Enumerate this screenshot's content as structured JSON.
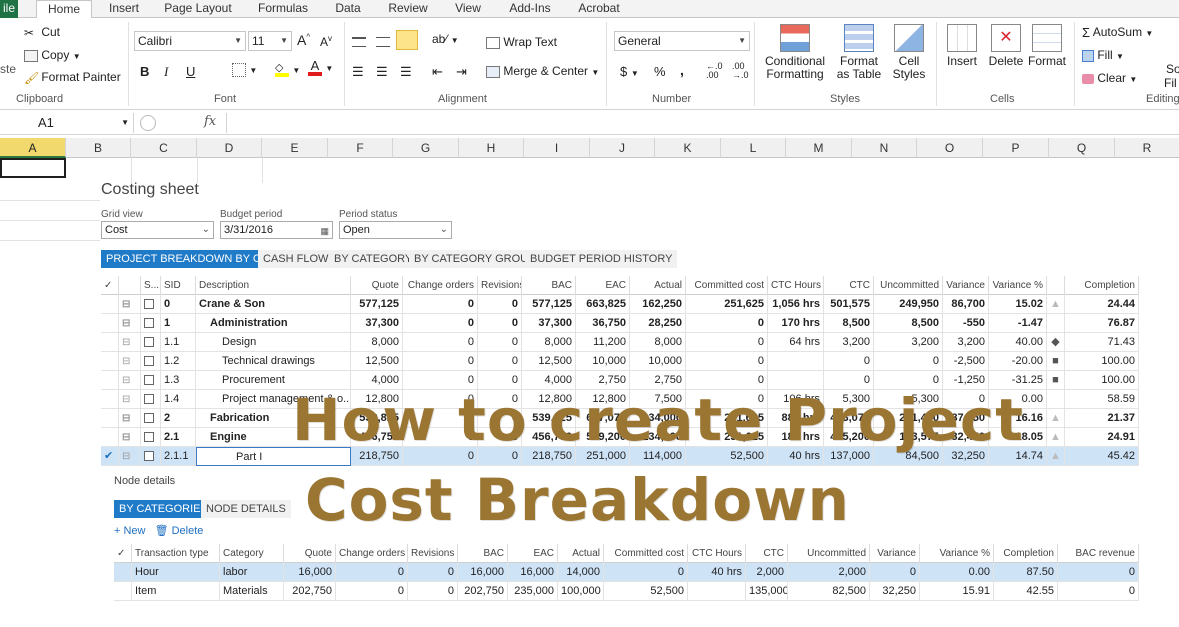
{
  "ribbon_tabs": [
    "ile",
    "Home",
    "Insert",
    "Page Layout",
    "Formulas",
    "Data",
    "Review",
    "View",
    "Add-Ins",
    "Acrobat"
  ],
  "clipboard": {
    "cut": "Cut",
    "copy": "Copy",
    "format_painter": "Format Painter",
    "paste_partial": "ste",
    "label": "Clipboard"
  },
  "font": {
    "name": "Calibri",
    "size": "11",
    "label": "Font",
    "bold": "B",
    "italic": "I",
    "underline": "U"
  },
  "alignment": {
    "wrap": "Wrap Text",
    "merge": "Merge & Center",
    "label": "Alignment"
  },
  "number": {
    "format": "General",
    "currency": "$",
    "percent": "%",
    "comma": ",",
    "label": "Number"
  },
  "styles": {
    "conditional": [
      "Conditional",
      "Formatting"
    ],
    "format_table": [
      "Format",
      "as Table"
    ],
    "cell_styles": [
      "Cell",
      "Styles"
    ],
    "label": "Styles"
  },
  "cells": {
    "insert": "Insert",
    "delete": "Delete",
    "format": "Format",
    "label": "Cells"
  },
  "editing": {
    "autosum": "AutoSum",
    "fill": "Fill",
    "clear": "Clear",
    "label": "Editing",
    "sort_partial": "So",
    "filter_partial": "Fil"
  },
  "formula_bar": {
    "cell_ref": "A1",
    "fx": "fx"
  },
  "columns": [
    "A",
    "B",
    "C",
    "D",
    "E",
    "F",
    "G",
    "H",
    "I",
    "J",
    "K",
    "L",
    "M",
    "N",
    "O",
    "P",
    "Q",
    "R"
  ],
  "costing": {
    "title": "Costing sheet",
    "grid_view_label": "Grid view",
    "grid_view_value": "Cost",
    "budget_period_label": "Budget period",
    "budget_period_value": "3/31/2016",
    "period_status_label": "Period status",
    "period_status_value": "Open",
    "tabs": [
      "PROJECT BREAKDOWN BY CBS",
      "CASH FLOW",
      "BY CATEGORY",
      "BY CATEGORY GROUP",
      "BUDGET PERIOD HISTORY"
    ],
    "headers": [
      "✓",
      "",
      "S...",
      "SID",
      "Description",
      "Quote",
      "Change orders",
      "Revisions",
      "BAC",
      "EAC",
      "Actual",
      "Committed cost",
      "CTC Hours",
      "CTC",
      "Uncommitted",
      "Variance",
      "Variance %",
      "",
      "Completion"
    ],
    "rows": [
      {
        "sid": "0",
        "desc": "Crane & Son",
        "level": 0,
        "bold": true,
        "quote": "577,125",
        "co": "0",
        "rev": "0",
        "bac": "577,125",
        "eac": "663,825",
        "actual": "162,250",
        "committed": "251,625",
        "ctch": "1,056 hrs",
        "ctc": "501,575",
        "uncommitted": "249,950",
        "variance": "86,700",
        "varpct": "15.02",
        "ind": "tri",
        "completion": "24.44"
      },
      {
        "sid": "1",
        "desc": "Administration",
        "level": 1,
        "bold": true,
        "quote": "37,300",
        "co": "0",
        "rev": "0",
        "bac": "37,300",
        "eac": "36,750",
        "actual": "28,250",
        "committed": "0",
        "ctch": "170 hrs",
        "ctc": "8,500",
        "uncommitted": "8,500",
        "variance": "-550",
        "varpct": "-1.47",
        "ind": "",
        "completion": "76.87"
      },
      {
        "sid": "1.1",
        "desc": "Design",
        "level": 2,
        "bold": false,
        "quote": "8,000",
        "co": "0",
        "rev": "0",
        "bac": "8,000",
        "eac": "11,200",
        "actual": "8,000",
        "committed": "0",
        "ctch": "64 hrs",
        "ctc": "3,200",
        "uncommitted": "3,200",
        "variance": "3,200",
        "varpct": "40.00",
        "ind": "dia",
        "completion": "71.43"
      },
      {
        "sid": "1.2",
        "desc": "Technical drawings",
        "level": 2,
        "bold": false,
        "quote": "12,500",
        "co": "0",
        "rev": "0",
        "bac": "12,500",
        "eac": "10,000",
        "actual": "10,000",
        "committed": "0",
        "ctch": "",
        "ctc": "0",
        "uncommitted": "0",
        "variance": "-2,500",
        "varpct": "-20.00",
        "ind": "sq",
        "completion": "100.00"
      },
      {
        "sid": "1.3",
        "desc": "Procurement",
        "level": 2,
        "bold": false,
        "quote": "4,000",
        "co": "0",
        "rev": "0",
        "bac": "4,000",
        "eac": "2,750",
        "actual": "2,750",
        "committed": "0",
        "ctch": "",
        "ctc": "0",
        "uncommitted": "0",
        "variance": "-1,250",
        "varpct": "-31.25",
        "ind": "sq",
        "completion": "100.00"
      },
      {
        "sid": "1.4",
        "desc": "Project management & o...",
        "level": 2,
        "bold": false,
        "quote": "12,800",
        "co": "0",
        "rev": "0",
        "bac": "12,800",
        "eac": "12,800",
        "actual": "7,500",
        "committed": "0",
        "ctch": "106 hrs",
        "ctc": "5,300",
        "uncommitted": "5,300",
        "variance": "0",
        "varpct": "0.00",
        "ind": "",
        "completion": "58.59"
      },
      {
        "sid": "2",
        "desc": "Fabrication",
        "level": 1,
        "bold": true,
        "quote": "539,825",
        "co": "0",
        "rev": "0",
        "bac": "539,825",
        "eac": "627,075",
        "actual": "134,000",
        "committed": "251,625",
        "ctch": "886 hrs",
        "ctc": "493,075",
        "uncommitted": "241,450",
        "variance": "87,250",
        "varpct": "16.16",
        "ind": "tri",
        "completion": "21.37"
      },
      {
        "sid": "2.1",
        "desc": "Engine",
        "level": 1,
        "bold": true,
        "quote": "456,750",
        "co": "0",
        "rev": "0",
        "bac": "456,750",
        "eac": "539,200",
        "actual": "134,000",
        "committed": "251,625",
        "ctch": "180 hrs",
        "ctc": "405,200",
        "uncommitted": "153,575",
        "variance": "82,450",
        "varpct": "18.05",
        "ind": "tri",
        "completion": "24.91"
      },
      {
        "sid": "2.1.1",
        "desc": "Part I",
        "level": 3,
        "bold": false,
        "quote": "218,750",
        "co": "0",
        "rev": "0",
        "bac": "218,750",
        "eac": "251,000",
        "actual": "114,000",
        "committed": "52,500",
        "ctch": "40 hrs",
        "ctc": "137,000",
        "uncommitted": "84,500",
        "variance": "32,250",
        "varpct": "14.74",
        "ind": "tri",
        "completion": "45.42",
        "selected": true
      }
    ]
  },
  "node": {
    "title": "Node details",
    "tabs": [
      "BY CATEGORIES",
      "NODE DETAILS"
    ],
    "new_label": "+ New",
    "delete_label": "Delete",
    "headers": [
      "✓",
      "Transaction type",
      "Category",
      "Quote",
      "Change orders",
      "Revisions",
      "BAC",
      "EAC",
      "Actual",
      "Committed cost",
      "CTC Hours",
      "CTC",
      "Uncommitted",
      "Variance",
      "Variance %",
      "Completion",
      "BAC revenue"
    ],
    "rows": [
      {
        "type": "Hour",
        "category": "labor",
        "quote": "16,000",
        "co": "0",
        "rev": "0",
        "bac": "16,000",
        "eac": "16,000",
        "actual": "14,000",
        "committed": "0",
        "ctch": "40 hrs",
        "ctc": "2,000",
        "uncommitted": "2,000",
        "variance": "0",
        "varpct": "0.00",
        "completion": "87.50",
        "bacrev": "0",
        "selected": true
      },
      {
        "type": "Item",
        "category": "Materials",
        "quote": "202,750",
        "co": "0",
        "rev": "0",
        "bac": "202,750",
        "eac": "235,000",
        "actual": "100,000",
        "committed": "52,500",
        "ctch": "",
        "ctc": "135,000",
        "uncommitted": "82,500",
        "variance": "32,250",
        "varpct": "15.91",
        "completion": "42.55",
        "bacrev": "0"
      }
    ]
  },
  "overlay": {
    "line1": "How to create Project",
    "line2": "Cost Breakdown"
  }
}
